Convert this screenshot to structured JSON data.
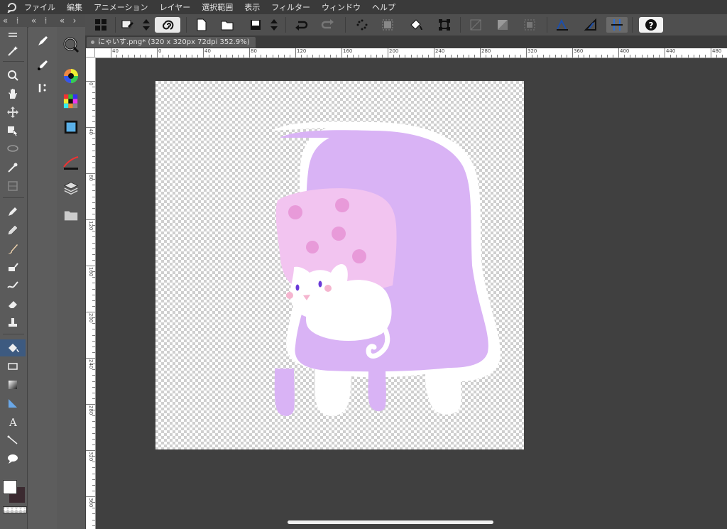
{
  "menubar": {
    "logo_icon": "clip-studio-logo-icon",
    "items": [
      "ファイル",
      "編集",
      "アニメーション",
      "レイヤー",
      "選択範囲",
      "表示",
      "フィルター",
      "ウィンドウ",
      "ヘルプ"
    ]
  },
  "document": {
    "tab_title": "にゃいす.png* (320 x 320px 72dpi 352.9%)"
  },
  "ruler": {
    "h_labels": [
      "40",
      "0",
      "40",
      "80",
      "120",
      "160",
      "200",
      "240",
      "280",
      "320",
      "360",
      "400",
      "440",
      "480"
    ],
    "v_labels": [
      "0",
      "40",
      "80",
      "120",
      "160",
      "200",
      "240",
      "280",
      "320",
      "360"
    ]
  },
  "colors": {
    "chair": "#d9b3f5",
    "cushion": "#f2c4f0",
    "flower": "#e89ad9",
    "cat": "#ffffff",
    "eye": "#6a3ad8",
    "blush": "#f5b5cf",
    "canvas_bg": "#404040",
    "main_color": "#ffffff",
    "sub_color": "#3b2a30"
  },
  "tools": {
    "column1": [
      "magic-wand-icon",
      "zoom-icon",
      "hand-icon",
      "move-layer-icon",
      "object-icon",
      "lasso-icon",
      "eyedropper-icon",
      "frame-icon",
      "pen-icon",
      "pencil-icon",
      "brush-icon",
      "airbrush-icon",
      "blend-icon",
      "eraser-icon",
      "stamp-icon",
      "fill-icon",
      "rectangle-icon",
      "gradient-icon",
      "ruler-icon",
      "text-icon",
      "correct-line-icon",
      "balloon-icon"
    ],
    "column2": [
      "sub-tool-pen-icon",
      "sub-tool-ink-icon",
      "sub-tool-marker-icon"
    ],
    "column3": [
      "navigator-icon",
      "color-wheel-icon",
      "color-set-icon",
      "animation-timeline-icon",
      "brush-size-icon",
      "layers-icon",
      "material-folder-icon"
    ]
  },
  "toolbar": {
    "icons": [
      "grid-layout-icon",
      "edit-icon",
      "up-down-arrows-icon",
      "spiral-icon",
      "new-document-icon",
      "open-folder-icon",
      "save-icon",
      "up-down-arrows-icon",
      "undo-icon",
      "redo-icon",
      "transform-dots-icon",
      "fill-selection-icon",
      "paint-bucket-icon",
      "scale-icon",
      "clear-icon",
      "gradient-fill-icon",
      "selection-border-icon",
      "ruler-snap-icon",
      "perspective-ruler-icon",
      "snap-special-icon",
      "help-icon"
    ]
  }
}
